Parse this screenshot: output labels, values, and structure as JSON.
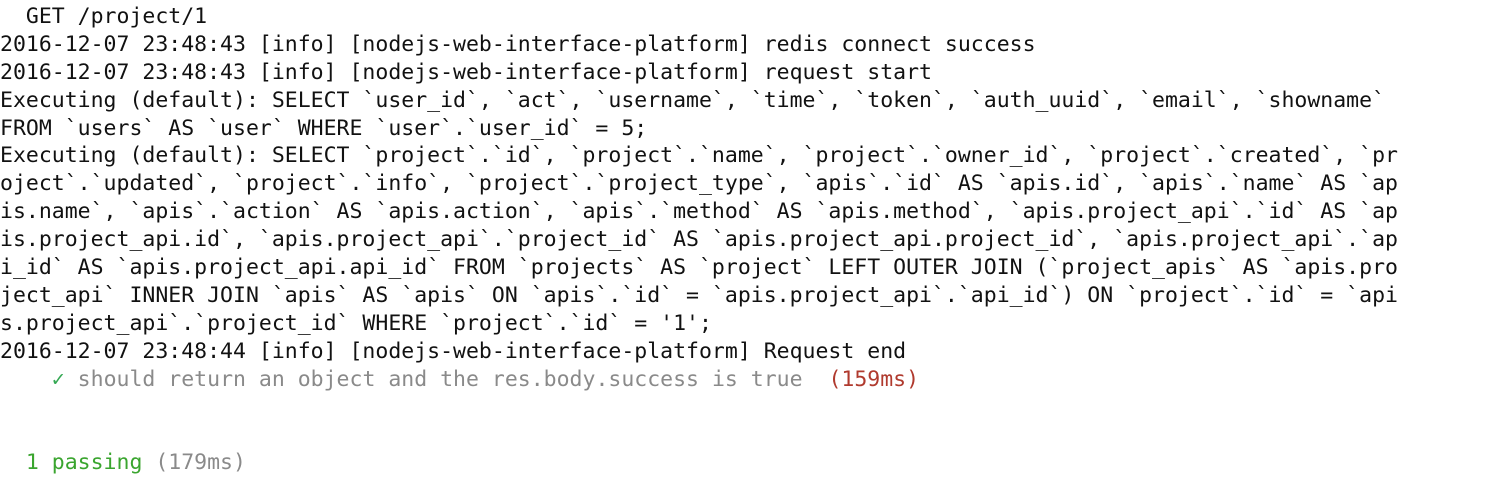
{
  "terminal": {
    "lines": [
      "  GET /project/1",
      "2016-12-07 23:48:43 [info] [nodejs-web-interface-platform] redis connect success",
      "2016-12-07 23:48:43 [info] [nodejs-web-interface-platform] request start",
      "Executing (default): SELECT `user_id`, `act`, `username`, `time`, `token`, `auth_uuid`, `email`, `showname`",
      "FROM `users` AS `user` WHERE `user`.`user_id` = 5;",
      "Executing (default): SELECT `project`.`id`, `project`.`name`, `project`.`owner_id`, `project`.`created`, `pr",
      "oject`.`updated`, `project`.`info`, `project`.`project_type`, `apis`.`id` AS `apis.id`, `apis`.`name` AS `ap",
      "is.name`, `apis`.`action` AS `apis.action`, `apis`.`method` AS `apis.method`, `apis.project_api`.`id` AS `ap",
      "is.project_api.id`, `apis.project_api`.`project_id` AS `apis.project_api.project_id`, `apis.project_api`.`ap",
      "i_id` AS `apis.project_api.api_id` FROM `projects` AS `project` LEFT OUTER JOIN (`project_apis` AS `apis.pro",
      "ject_api` INNER JOIN `apis` AS `apis` ON `apis`.`id` = `apis.project_api`.`api_id`) ON `project`.`id` = `api",
      "s.project_api`.`project_id` WHERE `project`.`id` = '1';",
      "2016-12-07 23:48:44 [info] [nodejs-web-interface-platform] Request end"
    ],
    "test_result": {
      "indent": "    ",
      "check_mark": "✓",
      "title": " should return an object and the res.body.success is true  ",
      "duration": "(159ms)"
    },
    "summary": {
      "indent": "  ",
      "passing": "1 passing",
      "time": " (179ms)"
    },
    "colors": {
      "text": "#111111",
      "check": "#34a853",
      "test_title": "#8a8a8a",
      "slow_duration": "#b03a2e",
      "passing": "#3aa52f"
    }
  }
}
